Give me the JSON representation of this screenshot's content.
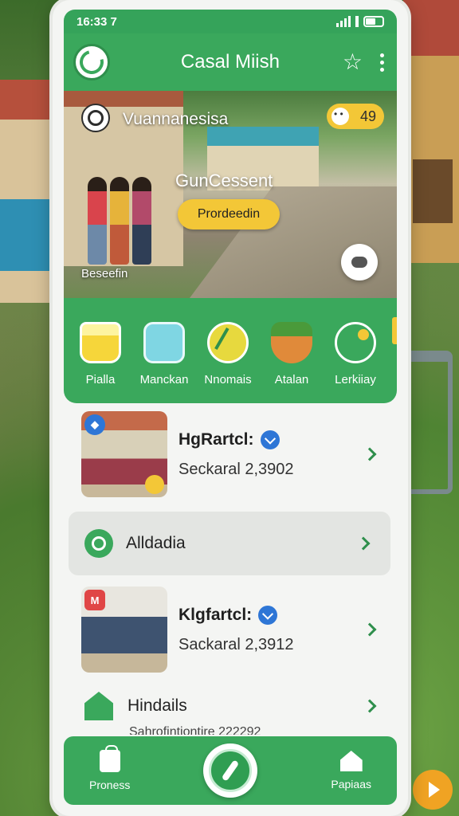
{
  "status_bar": {
    "time": "16:33 7"
  },
  "app_bar": {
    "title": "Casal Miish"
  },
  "hero": {
    "location": "Vuannanesisa",
    "chip_value": "49",
    "headline": "GunCessent",
    "button_label": "Prordeedin",
    "caption": "Beseefin"
  },
  "categories": [
    {
      "label": "Pialla",
      "icon": "basket-icon"
    },
    {
      "label": "Manckan",
      "icon": "calculator-icon"
    },
    {
      "label": "Nnomais",
      "icon": "leaf-icon"
    },
    {
      "label": "Atalan",
      "icon": "bowl-icon"
    },
    {
      "label": "Lerkiiay",
      "icon": "search-icon"
    }
  ],
  "list": {
    "card1": {
      "title": "HgRartcl:",
      "subtitle": "Seckaral 2,3902"
    },
    "row_alldadia": {
      "label": "Alldadia"
    },
    "card2": {
      "title": "Klgfartcl:",
      "subtitle": "Sackaral 2,3912"
    },
    "row_hindails": {
      "label": "Hindails",
      "subtext": "Sahrofintiontire 222292"
    }
  },
  "bottom_nav": {
    "left_label": "Proness",
    "right_label": "Papiaas"
  },
  "colors": {
    "brand_green": "#3aa85c",
    "accent_yellow": "#f3c737",
    "verified_blue": "#2e76d6",
    "fab_orange": "#f0a323"
  }
}
